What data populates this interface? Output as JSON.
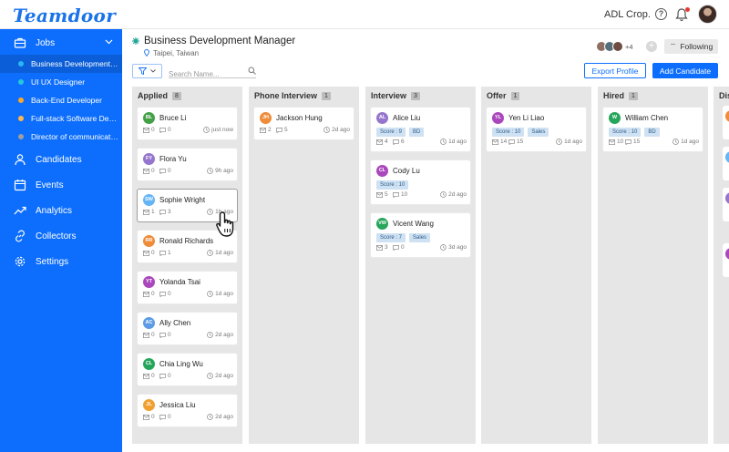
{
  "app": {
    "logo": "Teamdoor",
    "org": "ADL Crop."
  },
  "sidebar": {
    "jobs_label": "Jobs",
    "jobs": [
      {
        "label": "Business Development M...",
        "dot": "#29b6f6",
        "active": true
      },
      {
        "label": "UI UX Designer",
        "dot": "#26c6da",
        "active": false
      },
      {
        "label": "Back-End Developer",
        "dot": "#ffa726",
        "active": false
      },
      {
        "label": "Full-stack Software Devel...",
        "dot": "#ffb74d",
        "active": false
      },
      {
        "label": "Director of communicatio...",
        "dot": "#9e9e9e",
        "active": false
      }
    ],
    "nav": [
      {
        "label": "Candidates",
        "icon": "person-icon"
      },
      {
        "label": "Events",
        "icon": "calendar-icon"
      },
      {
        "label": "Analytics",
        "icon": "trend-icon"
      },
      {
        "label": "Collectors",
        "icon": "link-icon"
      },
      {
        "label": "Settings",
        "icon": "gear-icon"
      }
    ]
  },
  "job": {
    "title": "Business Development Manager",
    "location": "Taipei, Taiwan",
    "follower_count": "+4",
    "following_label": "Following"
  },
  "toolbar": {
    "search_placeholder": "Search Name...",
    "export_label": "Export Profile",
    "add_label": "Add Candidate"
  },
  "columns": [
    {
      "title": "Applied",
      "count": "8",
      "cards": [
        {
          "initials": "BL",
          "name": "Bruce Li",
          "color": "#43a047",
          "mail": "0",
          "chat": "0",
          "time": "just now",
          "tags": []
        },
        {
          "initials": "FY",
          "name": "Flora Yu",
          "color": "#9575cd",
          "mail": "0",
          "chat": "0",
          "time": "9h ago",
          "tags": []
        },
        {
          "initials": "SW",
          "name": "Sophie Wright",
          "color": "#64b5f6",
          "mail": "1",
          "chat": "3",
          "time": "1h ago",
          "tags": []
        },
        {
          "initials": "RR",
          "name": "Ronald Richards",
          "color": "#ef8c3a",
          "mail": "0",
          "chat": "1",
          "time": "1d ago",
          "tags": []
        },
        {
          "initials": "YT",
          "name": "Yolanda Tsai",
          "color": "#ab47bc",
          "mail": "0",
          "chat": "0",
          "time": "1d ago",
          "tags": []
        },
        {
          "initials": "AC",
          "name": "Ally Chen",
          "color": "#5c9ce6",
          "mail": "0",
          "chat": "0",
          "time": "2d ago",
          "tags": []
        },
        {
          "initials": "CL",
          "name": "Chia Ling Wu",
          "color": "#26a65b",
          "mail": "0",
          "chat": "0",
          "time": "2d ago",
          "tags": []
        },
        {
          "initials": "JL",
          "name": "Jessica Liu",
          "color": "#f0a030",
          "mail": "0",
          "chat": "0",
          "time": "2d ago",
          "tags": []
        }
      ]
    },
    {
      "title": "Phone Interview",
      "count": "1",
      "cards": [
        {
          "initials": "JH",
          "name": "Jackson Hung",
          "color": "#ef8c3a",
          "mail": "2",
          "chat": "5",
          "time": "2d ago",
          "tags": []
        }
      ]
    },
    {
      "title": "Interview",
      "count": "3",
      "cards": [
        {
          "initials": "AL",
          "name": "Alice Liu",
          "color": "#9575cd",
          "mail": "4",
          "chat": "6",
          "time": "1d ago",
          "tags": [
            "Score : 9",
            "BD"
          ]
        },
        {
          "initials": "CL",
          "name": "Cody Lu",
          "color": "#ab47bc",
          "mail": "5",
          "chat": "10",
          "time": "2d ago",
          "tags": [
            "Score : 10"
          ]
        },
        {
          "initials": "VW",
          "name": "Vicent Wang",
          "color": "#26a65b",
          "mail": "3",
          "chat": "0",
          "time": "3d ago",
          "tags": [
            "Score : 7",
            "Sales"
          ]
        }
      ]
    },
    {
      "title": "Offer",
      "count": "1",
      "cards": [
        {
          "initials": "YL",
          "name": "Yen Li Liao",
          "color": "#ab47bc",
          "mail": "14",
          "chat": "15",
          "time": "1d ago",
          "tags": [
            "Score : 10",
            "Sales"
          ]
        }
      ]
    },
    {
      "title": "Hired",
      "count": "1",
      "cards": [
        {
          "initials": "W",
          "name": "William Chen",
          "color": "#26a65b",
          "mail": "10",
          "chat": "15",
          "time": "1d ago",
          "tags": [
            "Score : 10",
            "BD"
          ]
        }
      ]
    }
  ],
  "partial_column": {
    "title": "Dis"
  }
}
